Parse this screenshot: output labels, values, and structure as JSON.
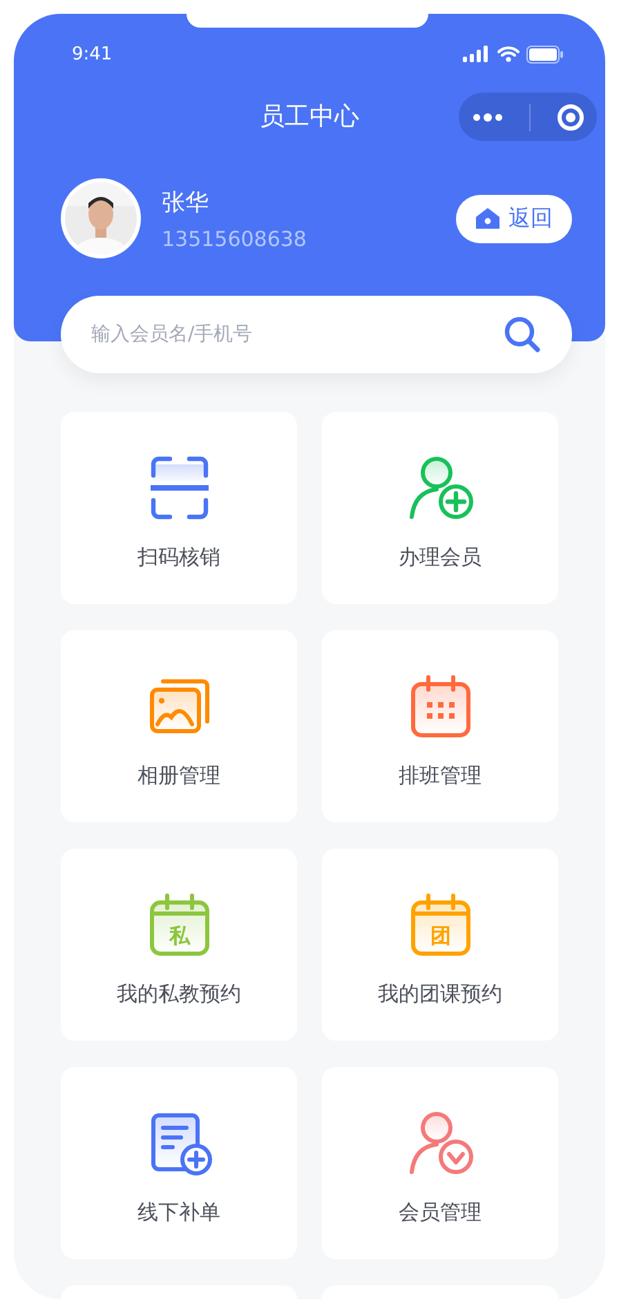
{
  "status_bar": {
    "time": "9:41"
  },
  "nav": {
    "title": "员工中心"
  },
  "profile": {
    "name": "张华",
    "phone": "13515608638",
    "back_button": "返回"
  },
  "search": {
    "placeholder": "输入会员名/手机号"
  },
  "tiles": [
    {
      "label": "扫码核销",
      "kind": "scan",
      "color": "#4a74f5"
    },
    {
      "label": "办理会员",
      "kind": "user-add",
      "color": "#18c15a"
    },
    {
      "label": "相册管理",
      "kind": "album",
      "color": "#ff8a00"
    },
    {
      "label": "排班管理",
      "kind": "calendar",
      "color": "#ff6a3d"
    },
    {
      "label": "我的私教预约",
      "kind": "calendar-text",
      "color": "#8cc63f",
      "icon_text": "私"
    },
    {
      "label": "我的团课预约",
      "kind": "calendar-text",
      "color": "#ffa200",
      "icon_text": "团"
    },
    {
      "label": "线下补单",
      "kind": "doc-add",
      "color": "#4a74f5"
    },
    {
      "label": "会员管理",
      "kind": "user-check",
      "color": "#f47a7a"
    }
  ]
}
